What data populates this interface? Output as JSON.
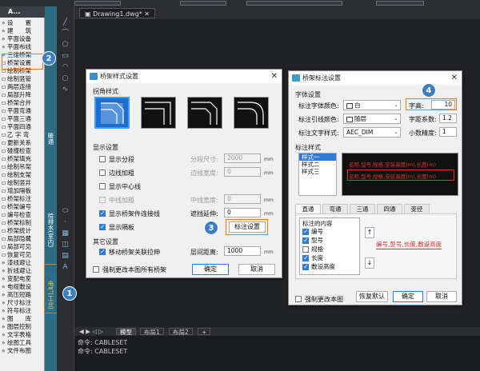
{
  "app": {
    "drawing_tab": "Drawing1.dwg*"
  },
  "panel": {
    "title": "A..."
  },
  "tree": [
    {
      "mark": "»",
      "label": "设　　置"
    },
    {
      "mark": "»",
      "label": "建　　筑"
    },
    {
      "mark": "»",
      "label": "平面设备"
    },
    {
      "mark": "»",
      "label": "平面布线"
    },
    {
      "mark": "»",
      "label": "三维桥架"
    },
    {
      "mark": "▫",
      "label": "桥架设置"
    },
    {
      "mark": "▫",
      "label": "绘制桥架"
    },
    {
      "mark": "▫",
      "label": "绘制竖管"
    },
    {
      "mark": "▫",
      "label": "两层连接"
    },
    {
      "mark": "▫",
      "label": "局部升降"
    },
    {
      "mark": "▫",
      "label": "桥架合并"
    },
    {
      "mark": "▫",
      "label": "平面弯通"
    },
    {
      "mark": "▫",
      "label": "平面三通"
    },
    {
      "mark": "▫",
      "label": "平面四通"
    },
    {
      "mark": "▫",
      "label": "乙 字 弯"
    },
    {
      "mark": "▫",
      "label": "更新关系"
    },
    {
      "mark": "▫",
      "label": "碰撞检查"
    },
    {
      "mark": "▫",
      "label": "桥架填充"
    },
    {
      "mark": "▫",
      "label": "绘制吊架"
    },
    {
      "mark": "▫",
      "label": "绘制支架"
    },
    {
      "mark": "▫",
      "label": "绘制竖井"
    },
    {
      "mark": "▫",
      "label": "增加隔板"
    },
    {
      "mark": "▫",
      "label": "桥架标注"
    },
    {
      "mark": "▫",
      "label": "桥架编号"
    },
    {
      "mark": "▫",
      "label": "编号检查"
    },
    {
      "mark": "▫",
      "label": "桥架标制"
    },
    {
      "mark": "▫",
      "label": "桥架统计"
    },
    {
      "mark": "▫",
      "label": "局部隐藏"
    },
    {
      "mark": "▫",
      "label": "局部可见"
    },
    {
      "mark": "▫",
      "label": "恢复可见"
    },
    {
      "mark": "»",
      "label": "漆线避让"
    },
    {
      "mark": "»",
      "label": "折线避让"
    },
    {
      "mark": "»",
      "label": "变配电室"
    },
    {
      "mark": "»",
      "label": "电缆敷设"
    },
    {
      "mark": "»",
      "label": "高压短路"
    },
    {
      "mark": "»",
      "label": "尺寸标注"
    },
    {
      "mark": "»",
      "label": "符号标注"
    },
    {
      "mark": "»",
      "label": "图　　库"
    },
    {
      "mark": "»",
      "label": "图层控制"
    },
    {
      "mark": "»",
      "label": "文字表格"
    },
    {
      "mark": "»",
      "label": "绘图工具"
    },
    {
      "mark": "»",
      "label": "文件布图"
    }
  ],
  "vtabs": {
    "t1": "暖通",
    "t2": "给排水(室内)",
    "t3": "电气(工业)"
  },
  "dlg1": {
    "title": "桥架样式设置",
    "corner_group": "拐角样式",
    "display_group": "显示设置",
    "cb_segment": "显示分段",
    "cb_edge": "边线加粗",
    "cb_center": "显示中心线",
    "cb_mid": "中线加粗",
    "cb_link": "显示桥架件连接线",
    "cb_divider": "显示隔板",
    "seg_size_label": "分段尺寸:",
    "seg_size_value": "2000",
    "edge_width_label": "边线宽度:",
    "edge_width_value": "0",
    "mid_width_label": "中线宽度:",
    "mid_width_value": "0",
    "blank_label": "遮挡延伸:",
    "blank_value": "0",
    "unit": "mm",
    "label_settings_btn": "标注设置",
    "other_group": "其它设置",
    "cb_move": "移动桥架关联拉伸",
    "layer_dist_label": "层间距离:",
    "layer_dist_value": "1000",
    "force_update": "强制更改本图所有桥架",
    "ok": "确定",
    "cancel": "取消"
  },
  "dlg2": {
    "title": "桥架标注设置",
    "font_group": "字体设置",
    "font_color_label": "标注字体颜色:",
    "font_color_value": "白",
    "line_color_label": "标注引线颜色:",
    "line_color_value": "随层",
    "text_style_label": "标注文字样式:",
    "text_style_value": "AEC_DIM",
    "height_label": "字高:",
    "height_value": "10",
    "width_factor_label": "字距系数:",
    "width_factor_value": "1.2",
    "decimal_label": "小数精度:",
    "decimal_value": "1",
    "style_group": "标注样式",
    "styles": [
      "样式一",
      "样式二",
      "样式三"
    ],
    "preview_text": "名称,型号,规格,安装高度(m),长度(m)",
    "tabs": [
      "直通",
      "弯通",
      "三通",
      "四通",
      "变径"
    ],
    "content_title": "标注的内容",
    "content_items": [
      {
        "label": "编号",
        "checked": true
      },
      {
        "label": "型号",
        "checked": true
      },
      {
        "label": "规格",
        "checked": false
      },
      {
        "label": "长度",
        "checked": true
      },
      {
        "label": "敷设高度",
        "checked": true
      }
    ],
    "result_text": "编号,型号,长度,敷设高度",
    "force_update": "强制更改本图",
    "reset": "恢复默认",
    "ok": "确定",
    "cancel": "取消"
  },
  "layout_tabs": {
    "model": "模型",
    "l1": "布局1",
    "l2": "布局2",
    "add": "+"
  },
  "cmd": {
    "line1": "命令: CABLESET",
    "line2": "命令: CABLESET"
  },
  "badges": {
    "b1": "1",
    "b2": "2",
    "b3": "3",
    "b4": "4"
  },
  "colors": {
    "accent": "#e07c17",
    "badge": "#3d7fc1",
    "preview_red": "#e03030"
  }
}
